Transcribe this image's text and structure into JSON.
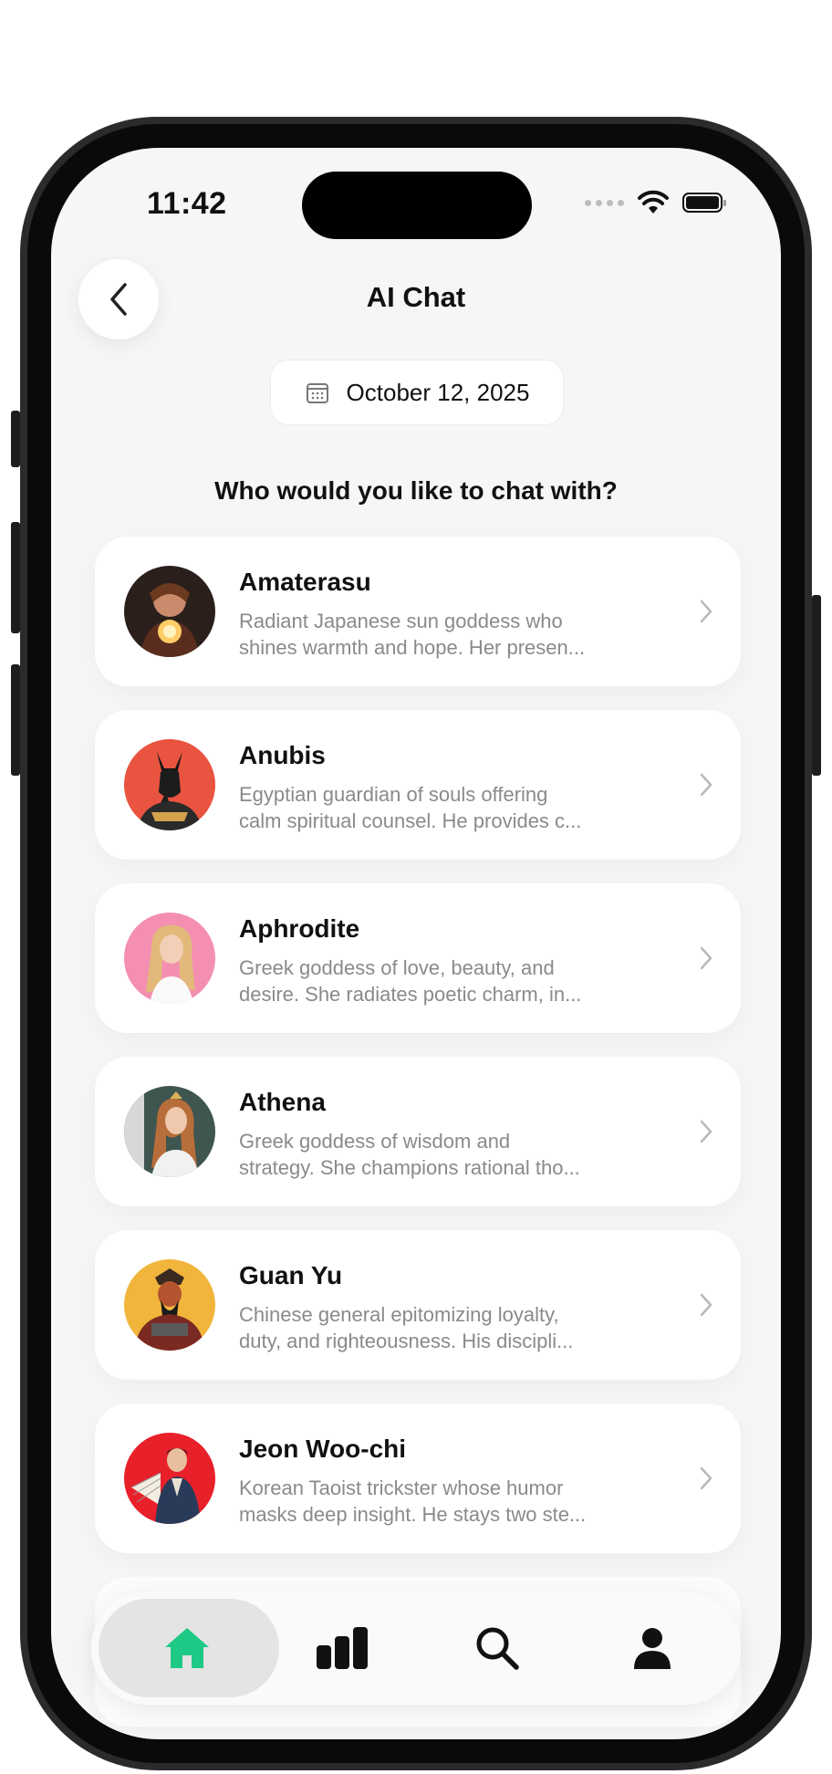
{
  "status_bar": {
    "time": "11:42"
  },
  "header": {
    "title": "AI Chat"
  },
  "date_pill": {
    "date": "October 12, 2025"
  },
  "prompt": "Who would you like to chat with?",
  "characters": [
    {
      "name": "Amaterasu",
      "desc1": "Radiant Japanese sun goddess who",
      "desc2": "shines warmth and hope. Her presen...",
      "avatar_bg": "#3a2a25",
      "accent": "#ffb74d"
    },
    {
      "name": "Anubis",
      "desc1": "Egyptian guardian of souls offering",
      "desc2": "calm spiritual counsel. He provides c...",
      "avatar_bg": "#e8543f",
      "accent": "#1a1a1a"
    },
    {
      "name": "Aphrodite",
      "desc1": "Greek goddess of love, beauty, and",
      "desc2": "desire. She radiates poetic charm, in...",
      "avatar_bg": "#f48fb1",
      "accent": "#e2b97a"
    },
    {
      "name": "Athena",
      "desc1": "Greek goddess of wisdom and",
      "desc2": "strategy. She champions rational tho...",
      "avatar_bg": "#3f5550",
      "accent": "#c9874f"
    },
    {
      "name": "Guan Yu",
      "desc1": "Chinese general epitomizing loyalty,",
      "desc2": "duty, and righteousness. His discipli...",
      "avatar_bg": "#f2b53c",
      "accent": "#7a2a22"
    },
    {
      "name": "Jeon Woo-chi",
      "desc1": "Korean Taoist trickster whose humor",
      "desc2": "masks deep insight. He stays two ste...",
      "avatar_bg": "#e8202a",
      "accent": "#2a3b5a"
    }
  ],
  "colors": {
    "accent": "#1ec986",
    "background": "#f5f6f7",
    "card": "#ffffff",
    "muted_text": "#8a8a8a"
  },
  "nav": {
    "items": [
      {
        "icon": "home-icon",
        "active": true
      },
      {
        "icon": "bar-chart-icon",
        "active": false
      },
      {
        "icon": "search-icon",
        "active": false
      },
      {
        "icon": "profile-icon",
        "active": false
      }
    ]
  }
}
